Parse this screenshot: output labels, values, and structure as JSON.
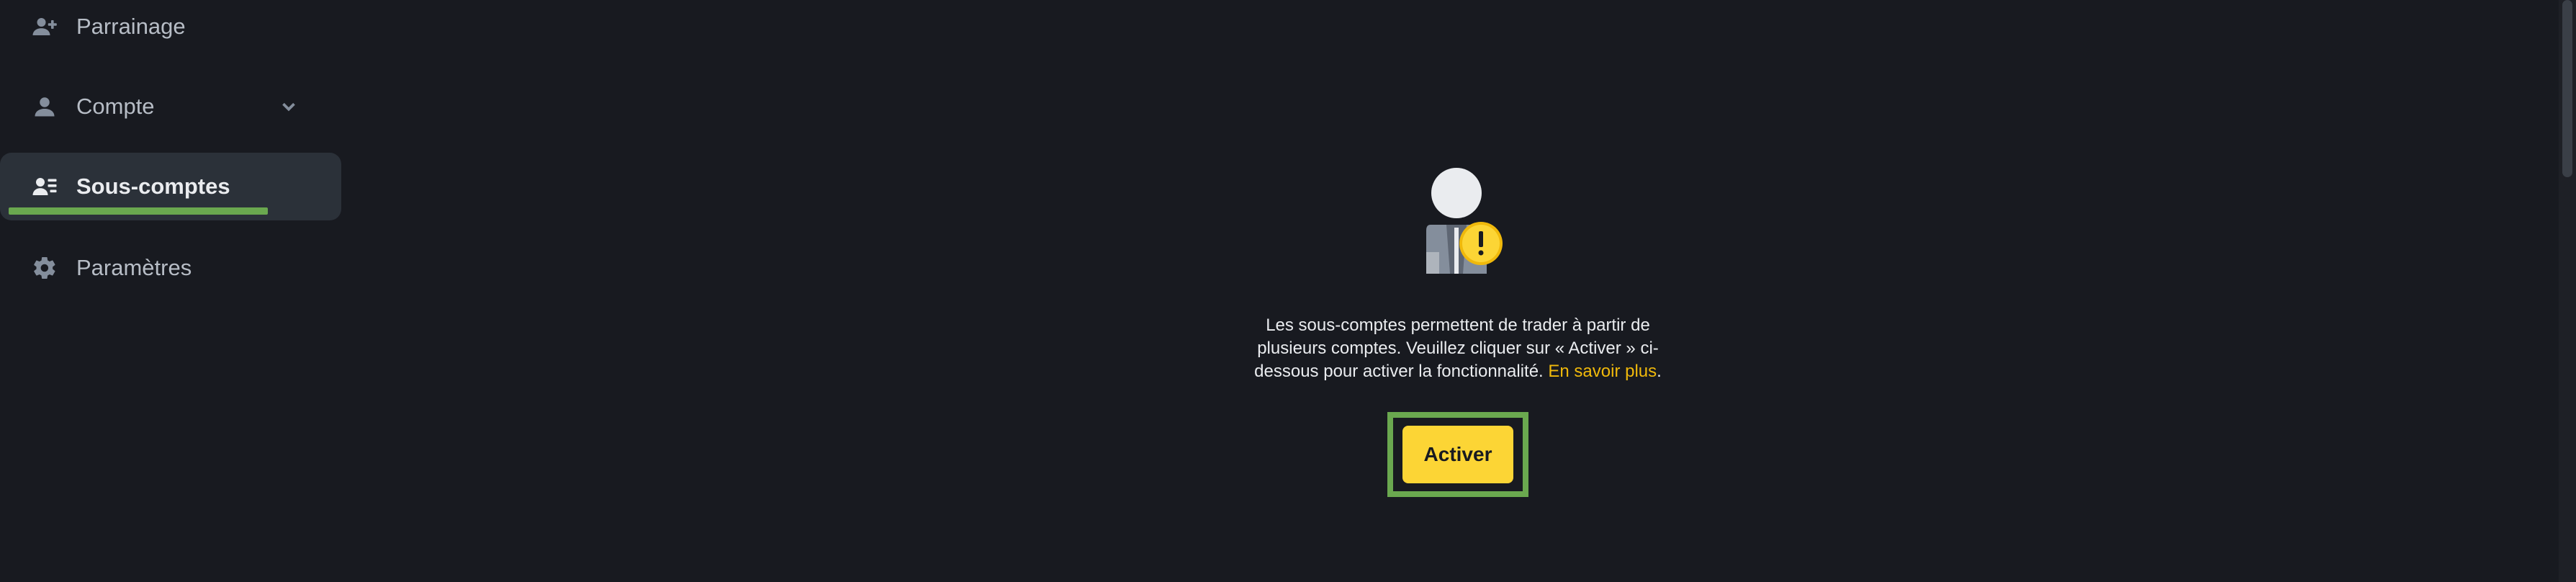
{
  "sidebar": {
    "items": [
      {
        "label": "Parrainage",
        "icon": "user-plus-icon"
      },
      {
        "label": "Compte",
        "icon": "user-icon",
        "expandable": true
      },
      {
        "label": "Sous-comptes",
        "icon": "user-list-icon",
        "active": true
      },
      {
        "label": "Paramètres",
        "icon": "gear-icon"
      }
    ]
  },
  "empty_state": {
    "illustration": "person-warning-icon",
    "description": "Les sous-comptes permettent de trader à partir de plusieurs comptes. Veuillez cliquer sur « Activer » ci-dessous pour activer la fonctionnalité.",
    "learn_more_label": "En savoir plus",
    "trailing_period": ".",
    "activate_label": "Activer"
  },
  "colors": {
    "background": "#181a20",
    "accent": "#fcd535",
    "link": "#f0b90b",
    "highlight": "#6aa84f"
  }
}
